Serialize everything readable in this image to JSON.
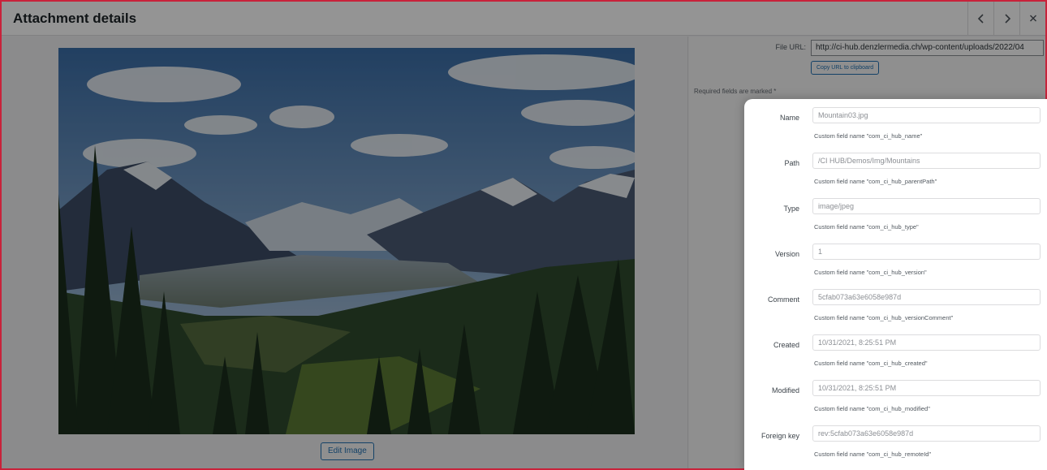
{
  "header": {
    "title": "Attachment details",
    "prev_icon": "chevron-left-icon",
    "next_icon": "chevron-right-icon",
    "close_icon": "close-icon"
  },
  "preview": {
    "edit_button_label": "Edit Image"
  },
  "details": {
    "file_url_label": "File URL:",
    "file_url_value": "http://ci-hub.denzlermedia.ch/wp-content/uploads/2022/04",
    "copy_button_label": "Copy URL to clipboard",
    "required_note": "Required fields are marked *"
  },
  "fields": [
    {
      "label": "Name",
      "value": "Mountain03.jpg",
      "description": "Custom field name \"com_ci_hub_name\""
    },
    {
      "label": "Path",
      "value": "/CI HUB/Demos/Img/Mountains",
      "description": "Custom field name \"com_ci_hub_parentPath\""
    },
    {
      "label": "Type",
      "value": "image/jpeg",
      "description": "Custom field name \"com_ci_hub_type\""
    },
    {
      "label": "Version",
      "value": "1",
      "description": "Custom field name \"com_ci_hub_version\""
    },
    {
      "label": "Comment",
      "value": "5cfab073a63e6058e987d",
      "description": "Custom field name \"com_ci_hub_versionComment\""
    },
    {
      "label": "Created",
      "value": "10/31/2021, 8:25:51 PM",
      "description": "Custom field name \"com_ci_hub_created\""
    },
    {
      "label": "Modified",
      "value": "10/31/2021, 8:25:51 PM",
      "description": "Custom field name \"com_ci_hub_modified\""
    },
    {
      "label": "Foreign key",
      "value": "rev:5cfab073a63e6058e987d",
      "description": "Custom field name \"com_ci_hub_remoteId\""
    }
  ],
  "colors": {
    "frame_border": "#c8223a",
    "accent": "#2271b1"
  }
}
